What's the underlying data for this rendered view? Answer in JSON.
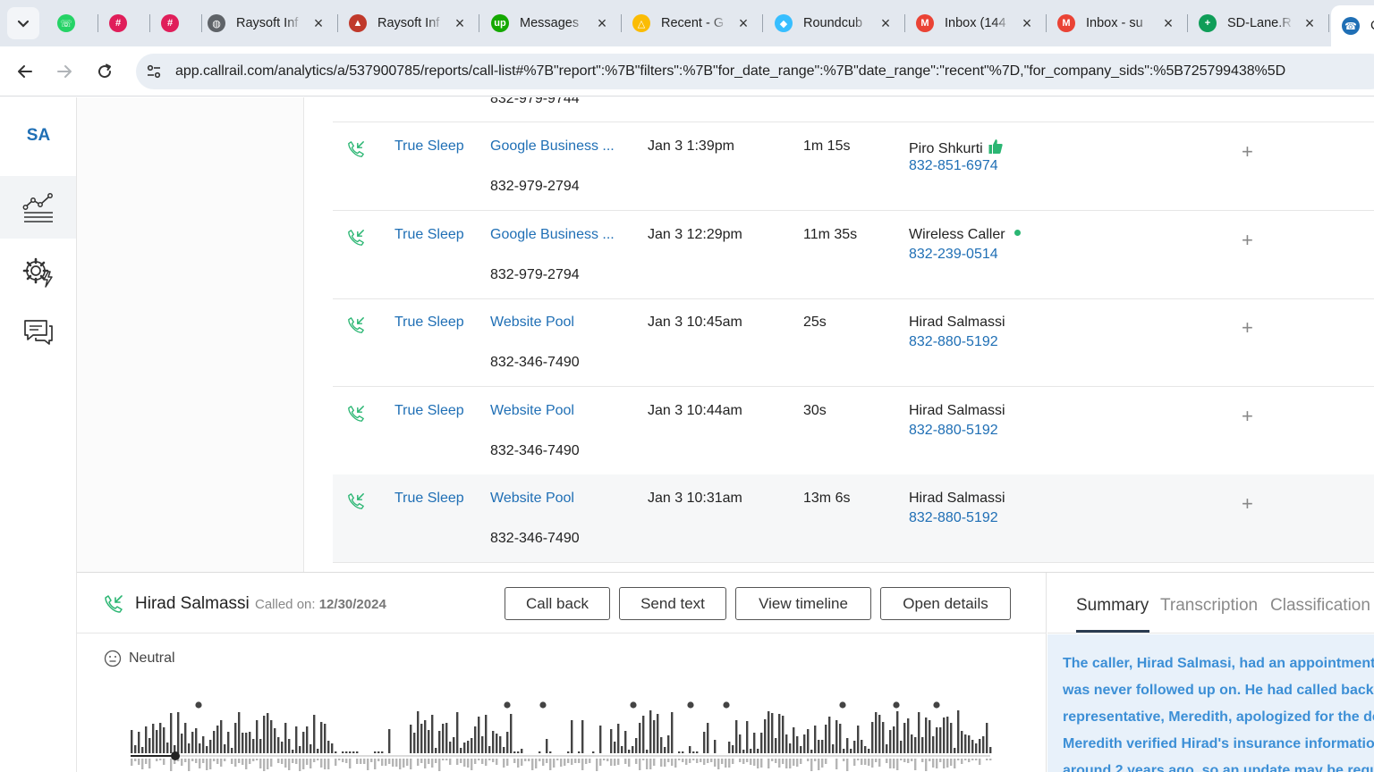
{
  "browser": {
    "tabs": [
      {
        "title": "",
        "icon": "whatsapp-icon",
        "color": "#25d366"
      },
      {
        "title": "",
        "icon": "slack-icon",
        "color": "#e01e5a"
      },
      {
        "title": "",
        "icon": "slack-icon",
        "color": "#e01e5a"
      },
      {
        "title": "Raysoft Inf",
        "icon": "globe-icon",
        "color": "#5f6368"
      },
      {
        "title": "Raysoft Inf",
        "icon": "graduation-cap-icon",
        "color": "#c0392b"
      },
      {
        "title": "Messages",
        "icon": "upwork-icon",
        "color": "#14a800"
      },
      {
        "title": "Recent - G",
        "icon": "google-drive-icon",
        "color": "#fbbc04"
      },
      {
        "title": "Roundcub",
        "icon": "roundcube-icon",
        "color": "#37beff"
      },
      {
        "title": "Inbox (144",
        "icon": "gmail-icon",
        "color": "#ea4335"
      },
      {
        "title": "Inbox - su",
        "icon": "gmail-icon",
        "color": "#ea4335"
      },
      {
        "title": "SD-Lane.R",
        "icon": "google-sheets-icon",
        "color": "#0f9d58"
      },
      {
        "title": "C",
        "icon": "phone-icon",
        "color": "#1f6fb5"
      }
    ],
    "url": "app.callrail.com/analytics/a/537900785/reports/call-list#%7B\"report\":%7B\"filters\":%7B\"for_date_range\":%7B\"date_range\":\"recent\"%7D,\"for_company_sids\":%5B725799438%5D"
  },
  "sidebar": {
    "logo": "SA",
    "items": [
      {
        "name": "analytics",
        "icon": "analytics-chart-icon"
      },
      {
        "name": "settings",
        "icon": "gear-lightning-icon"
      },
      {
        "name": "conversations",
        "icon": "chat-bubbles-icon"
      }
    ]
  },
  "calls": {
    "partial_row": {
      "tracking_number": "832-979-9744"
    },
    "rows": [
      {
        "company": "True Sleep",
        "source": "Google Business ...",
        "tracking_number": "832-979-2794",
        "date": "Jan 3 1:39pm",
        "duration": "1m 15s",
        "caller": "Piro Shkurti",
        "caller_phone": "832-851-6974",
        "badge": "thumbs-up-icon"
      },
      {
        "company": "True Sleep",
        "source": "Google Business ...",
        "tracking_number": "832-979-2794",
        "date": "Jan 3 12:29pm",
        "duration": "11m 35s",
        "caller": "Wireless Caller",
        "caller_phone": "832-239-0514",
        "badge": "green-dot"
      },
      {
        "company": "True Sleep",
        "source": "Website Pool",
        "tracking_number": "832-346-7490",
        "date": "Jan 3 10:45am",
        "duration": "25s",
        "caller": "Hirad Salmassi",
        "caller_phone": "832-880-5192",
        "badge": ""
      },
      {
        "company": "True Sleep",
        "source": "Website Pool",
        "tracking_number": "832-346-7490",
        "date": "Jan 3 10:44am",
        "duration": "30s",
        "caller": "Hirad Salmassi",
        "caller_phone": "832-880-5192",
        "badge": ""
      },
      {
        "company": "True Sleep",
        "source": "Website Pool",
        "tracking_number": "832-346-7490",
        "date": "Jan 3 10:31am",
        "duration": "13m 6s",
        "caller": "Hirad Salmassi",
        "caller_phone": "832-880-5192",
        "badge": ""
      }
    ]
  },
  "detail": {
    "caller": "Hirad Salmassi",
    "called_on_label": "Called on:",
    "called_on_date": "12/30/2024",
    "buttons": {
      "call_back": "Call back",
      "send_text": "Send text",
      "view_timeline": "View timeline",
      "open_details": "Open details"
    },
    "sentiment": "Neutral",
    "tabs": [
      "Summary",
      "Transcription",
      "Classification"
    ],
    "active_tab": "Summary",
    "summary_lines": [
      "The caller, Hirad Salmasi, had an appointment",
      "was never followed up on. He had called back t",
      "representative, Meredith, apologized for the de",
      "Meredith verified Hirad's insurance informatio",
      "around 2 years ago, so an update may be requ"
    ]
  },
  "colors": {
    "link": "#1f6fb5",
    "accent_green": "#2bb673",
    "summary_text": "#3c8fd6",
    "summary_bg": "#e8f1fa"
  }
}
